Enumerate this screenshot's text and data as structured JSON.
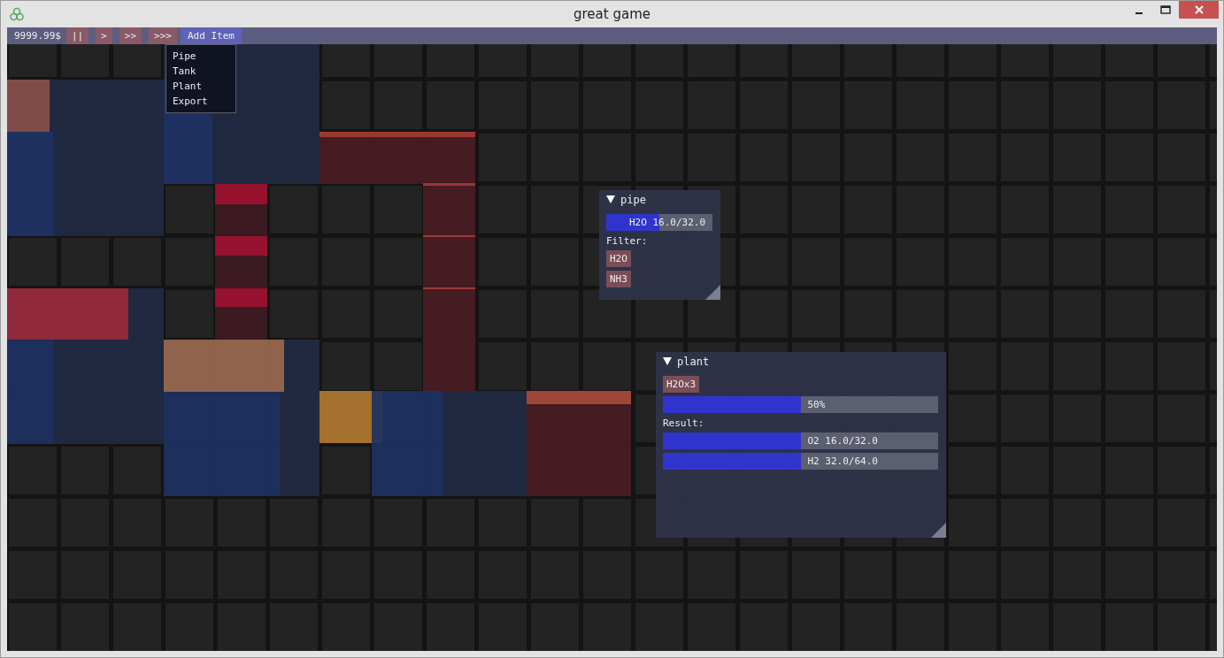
{
  "window": {
    "title": "great game"
  },
  "menu_bar": {
    "money": "9999.99$",
    "speed_buttons": [
      "||",
      ">",
      ">>",
      ">>>"
    ]
  },
  "add_item_menu": {
    "label": "Add Item",
    "open": true,
    "items": [
      "Pipe",
      "Tank",
      "Plant",
      "Export"
    ]
  },
  "pipe_window": {
    "title": "pipe",
    "expanded": true,
    "content": {
      "label": "H2O 16.0/32.0",
      "level": 0.5
    },
    "filter_label": "Filter:",
    "filters": [
      "H2O",
      "NH3"
    ]
  },
  "plant_window": {
    "title": "plant",
    "expanded": true,
    "recipe": "H2Ox3",
    "progress": {
      "label": "50%",
      "level": 0.5
    },
    "result_label": "Result:",
    "results": [
      {
        "label": "O2 16.0/32.0",
        "level": 0.5
      },
      {
        "label": "H2 32.0/64.0",
        "level": 0.5
      }
    ]
  }
}
